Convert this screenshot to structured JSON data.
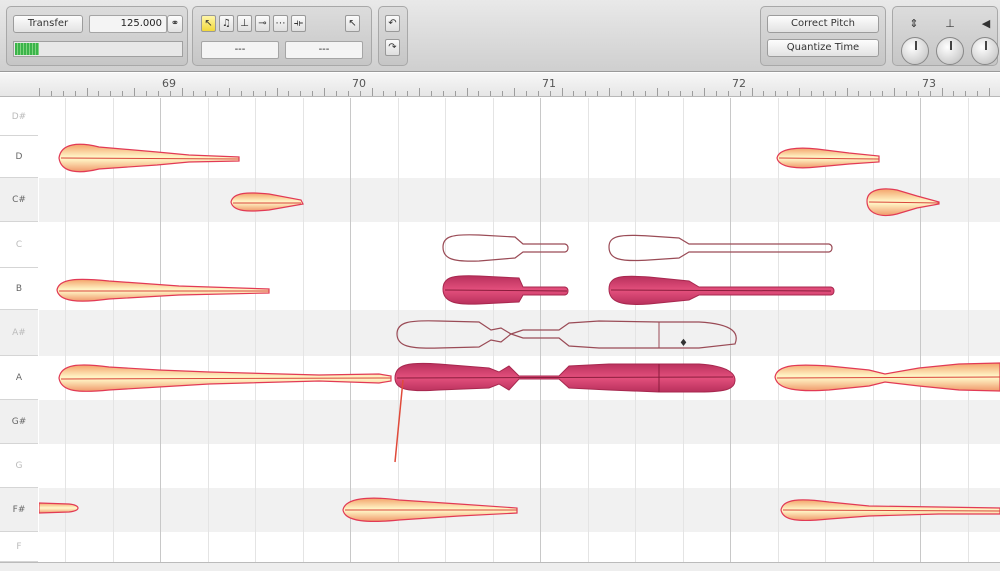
{
  "toolbar": {
    "transfer_label": "Transfer",
    "tempo_value": "125.000",
    "field_left_value": "---",
    "field_right_value": "---",
    "correct_pitch_label": "Correct Pitch",
    "quantize_time_label": "Quantize Time",
    "tools": [
      "pointer-icon",
      "pitch-tool-icon",
      "amplitude-tool-icon",
      "time-tool-icon",
      "formant-tool-icon",
      "separation-tool-icon"
    ],
    "colors": {
      "active_tool": "#f2d83a",
      "meter_green": "#3bb44a"
    }
  },
  "ruler": {
    "bar_numbers": [
      "69",
      "70",
      "71",
      "72",
      "73"
    ]
  },
  "keyboard": {
    "notes": [
      "D#",
      "D",
      "C#",
      "C",
      "B",
      "A#",
      "A",
      "G#",
      "G",
      "F#",
      "F"
    ]
  },
  "blob_colors": {
    "unselected_fill": "#fbe3a0",
    "unselected_edge": "#e13b5b",
    "selected_fill": "#d63e6e",
    "outline": "#9a4b56"
  }
}
